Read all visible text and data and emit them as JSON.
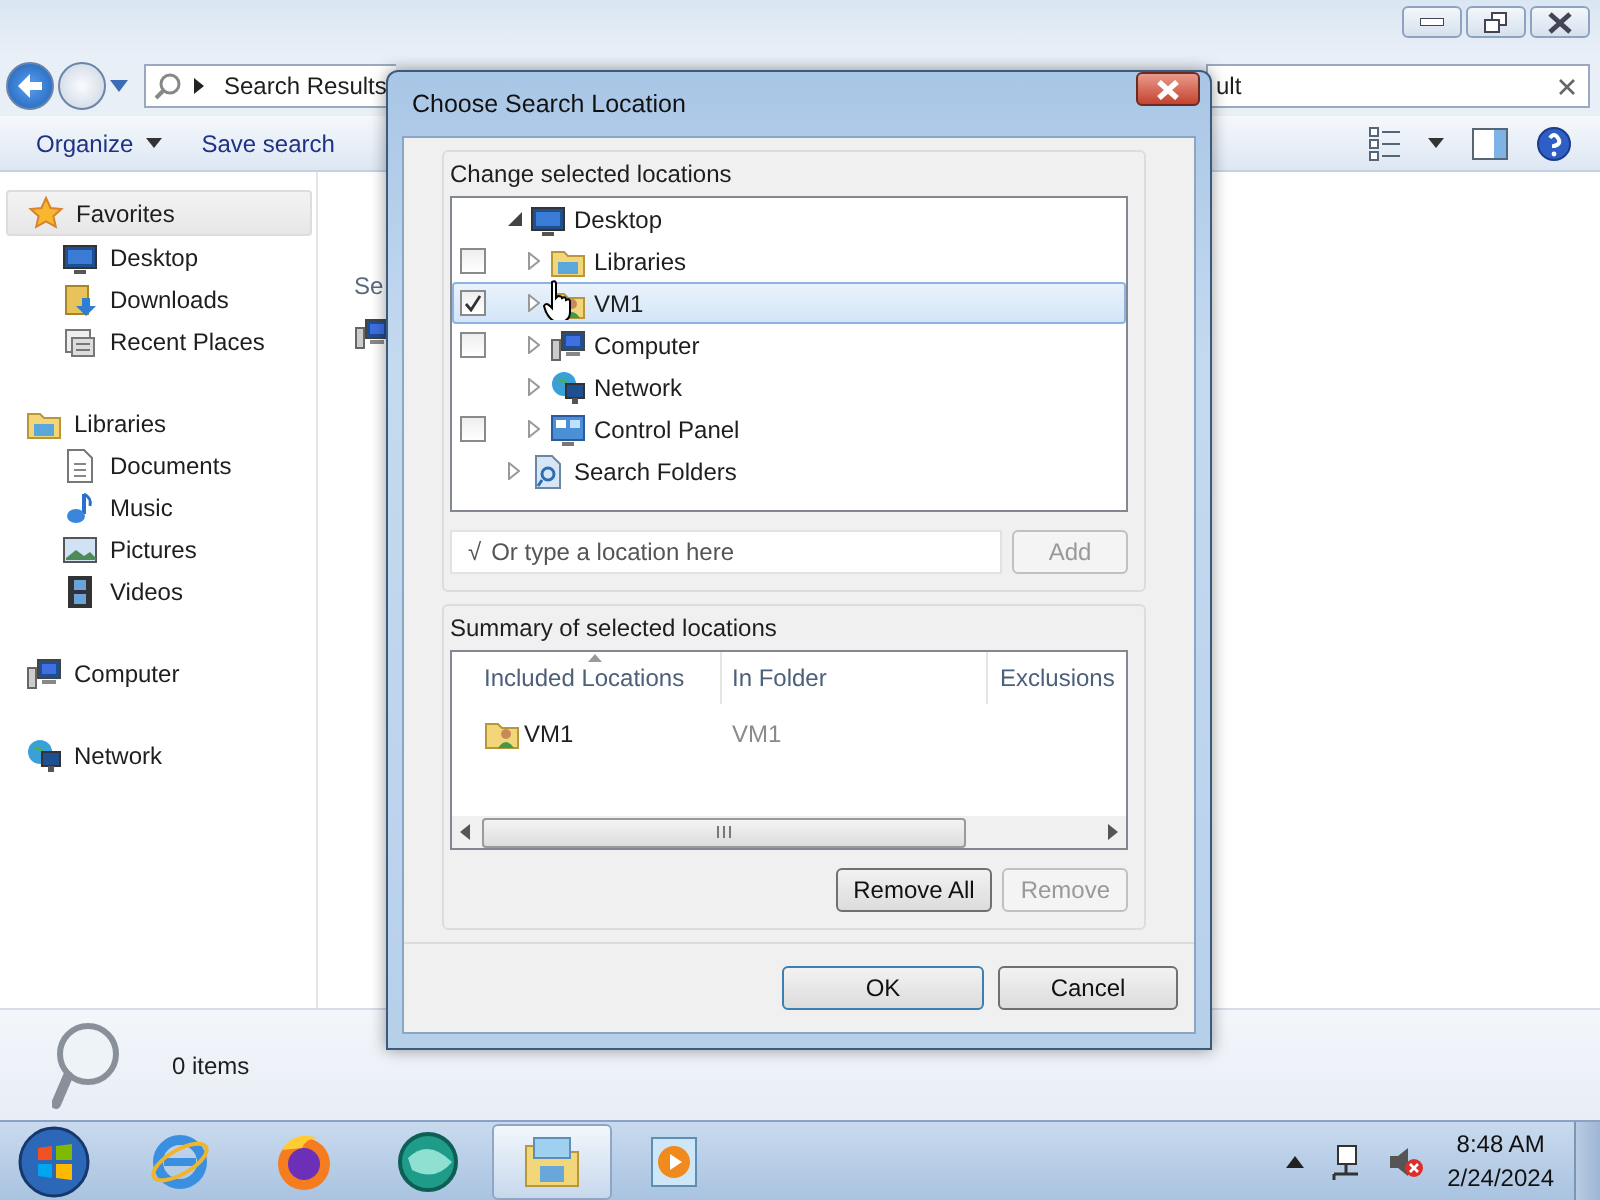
{
  "explorer": {
    "address": {
      "text": "Search Results"
    },
    "search": {
      "value": "ult"
    },
    "toolbar": [
      {
        "label": "Organize",
        "dropdown": true
      },
      {
        "label": "Save search",
        "dropdown": false
      }
    ],
    "sidebar": [
      {
        "label": "Favorites",
        "selected": true,
        "children": [
          {
            "label": "Desktop",
            "selected": false
          },
          {
            "label": "Downloads",
            "selected": false
          },
          {
            "label": "Recent Places",
            "selected": false
          }
        ]
      },
      {
        "label": "Libraries",
        "selected": false,
        "children": [
          {
            "label": "Documents",
            "selected": false
          },
          {
            "label": "Music",
            "selected": false
          },
          {
            "label": "Pictures",
            "selected": false
          },
          {
            "label": "Videos",
            "selected": false
          }
        ]
      },
      {
        "label": "Computer",
        "selected": false
      },
      {
        "label": "Network",
        "selected": false
      }
    ],
    "content_heading": "Se",
    "status": "0 items"
  },
  "dialog": {
    "title": "Choose Search Location",
    "locations_group": "Change selected locations",
    "tree": [
      {
        "label": "Desktop",
        "kind": "plain",
        "expanded": true,
        "selected": false,
        "children": [
          {
            "label": "Libraries",
            "kind": "checkbox",
            "checked": false,
            "selected": false
          },
          {
            "label": "VM1",
            "kind": "checkbox",
            "checked": true,
            "selected": true
          },
          {
            "label": "Computer",
            "kind": "checkbox",
            "checked": false,
            "selected": false
          },
          {
            "label": "Network",
            "kind": "plain",
            "selected": false
          },
          {
            "label": "Control Panel",
            "kind": "checkbox",
            "checked": false,
            "selected": false
          }
        ]
      },
      {
        "label": "Search Folders",
        "kind": "plain",
        "expanded": false,
        "selected": false
      }
    ],
    "location_field": {
      "prefix": "√",
      "placeholder": "Or type a location here"
    },
    "add_button": {
      "label": "Add",
      "disabled": true
    },
    "summary_group": "Summary of selected locations",
    "columns": [
      {
        "label": "Included Locations",
        "sorted": true
      },
      {
        "label": "In Folder",
        "sorted": false
      },
      {
        "label": "Exclusions",
        "sorted": false
      }
    ],
    "rows": [
      {
        "name": "VM1",
        "in_folder": "VM1"
      }
    ],
    "summary_buttons": [
      {
        "label": "Remove All",
        "disabled": false
      },
      {
        "label": "Remove",
        "disabled": true
      }
    ],
    "buttons": [
      {
        "label": "OK",
        "default": true
      },
      {
        "label": "Cancel",
        "default": false
      }
    ]
  },
  "taskbar": {
    "apps": [
      {
        "active": false
      },
      {
        "active": false
      },
      {
        "active": false
      },
      {
        "active": true
      },
      {
        "active": false
      }
    ],
    "time": "8:48 AM",
    "date": "2/24/2024"
  }
}
